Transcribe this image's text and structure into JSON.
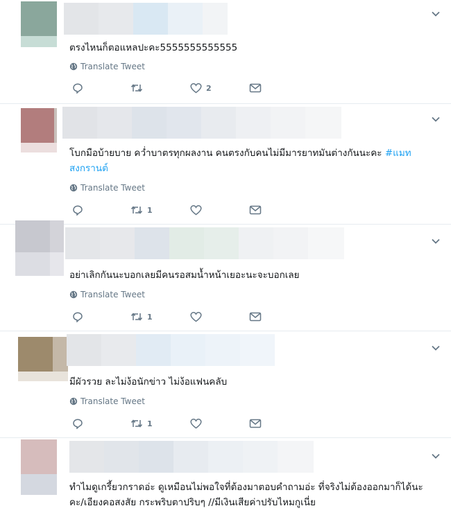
{
  "tweets": [
    {
      "text": "ตรงไหนก็ตอแหลปะคะ5555555555555",
      "hashtag": "",
      "translate_label": "Translate Tweet",
      "reply_count": "",
      "retweet_count": "",
      "like_count": "2",
      "avatar_colors": [
        "#8aa79c",
        "#c7ddd6",
        "#e6efec",
        "#f2f6f5"
      ]
    },
    {
      "text": "โบกมือบ้ายบาย คว่ำบาตรทุกผลงาน คนตรงกับคนไม่มีมารยาทมันต่างกันนะคะ ",
      "hashtag": "#แมท สงกรานต์",
      "translate_label": "Translate Tweet",
      "reply_count": "",
      "retweet_count": "1",
      "like_count": "",
      "avatar_colors": [
        "#b27d7d",
        "#c9c0bb",
        "#ecdede",
        "#f5efef"
      ]
    },
    {
      "text": "อย่าเลิกกันนะบอกเลยมีคนรอสมน้ำหน้าเยอะนะจะบอกเลย",
      "hashtag": "",
      "translate_label": "Translate Tweet",
      "reply_count": "",
      "retweet_count": "1",
      "like_count": "",
      "avatar_colors": [
        "#c7c8cf",
        "#d6d6db",
        "#dedee4",
        "#e8e8ec"
      ]
    },
    {
      "text": "มีผัวรวย ละไม่ง้อนักข่าว ไม่ง้อแฟนคลับ",
      "hashtag": "",
      "translate_label": "Translate Tweet",
      "reply_count": "",
      "retweet_count": "1",
      "like_count": "",
      "avatar_colors": [
        "#9d8a6c",
        "#c4b8a8",
        "#e4ddd2",
        "#f0ece6"
      ]
    },
    {
      "text": "ทำไมดูเกรี้ยวกราดอ่ะ ดูเหมือนไม่พอใจที่ต้องมาตอบคำถามอ่ะ ที่จริงไม่ต้องออกมาก็ได้นะคะ/เอียงคอสงสัย กระพริบตาปริบๆ //มีเงินเสียค่าปรับไหมกูเนี่ย",
      "hashtag": "",
      "translate_label": "",
      "reply_count": "",
      "retweet_count": "",
      "like_count": "",
      "avatar_colors": [
        "#d6bcbc",
        "#e2d7d7",
        "#d4d8e0",
        "#eceef2"
      ]
    }
  ],
  "icons": {
    "reply": "reply-icon",
    "retweet": "retweet-icon",
    "like": "heart-icon",
    "dm": "envelope-icon",
    "globe": "globe-icon",
    "caret": "chevron-down-icon"
  }
}
